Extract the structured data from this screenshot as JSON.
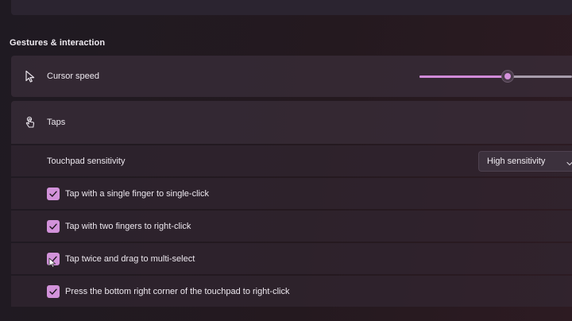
{
  "section": {
    "title": "Gestures & interaction"
  },
  "cursor_speed": {
    "label": "Cursor speed",
    "icon": "cursor-arrow-icon",
    "slider_value_fraction": 0.58
  },
  "taps": {
    "label": "Taps",
    "icon": "tap-hand-icon",
    "sensitivity": {
      "label": "Touchpad sensitivity",
      "selected": "High sensitivity"
    },
    "options": [
      {
        "label": "Tap with a single finger to single-click",
        "checked": true
      },
      {
        "label": "Tap with two fingers to right-click",
        "checked": true
      },
      {
        "label": "Tap twice and drag to multi-select",
        "checked": true
      },
      {
        "label": "Press the bottom right corner of the touchpad to right-click",
        "checked": true
      }
    ]
  },
  "colors": {
    "accent": "#d292da",
    "card": "#3a2e3a",
    "background": "#221a20"
  }
}
